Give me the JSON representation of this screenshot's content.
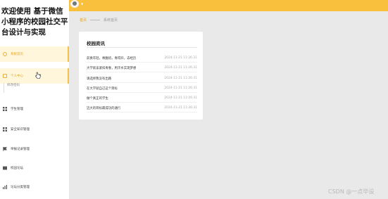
{
  "sidebar": {
    "app_title": "欢迎使用 基于微信小程序的校园社交平台设计与实现",
    "items": [
      {
        "label": "系统首页",
        "icon": "home-icon"
      },
      {
        "label": "个人中心",
        "icon": "user-icon"
      },
      {
        "label": "修改密码"
      },
      {
        "label": "学生管理",
        "icon": "grid-icon"
      },
      {
        "label": "安全知识管理",
        "icon": "grid-icon"
      },
      {
        "label": "举报记录管理",
        "icon": "flag-icon"
      },
      {
        "label": "校园论坛",
        "icon": "card-icon"
      },
      {
        "label": "论坛分类管理",
        "icon": "chart-icon"
      }
    ]
  },
  "breadcrumb": {
    "home": "首页",
    "current": "系统首页"
  },
  "news": {
    "title": "校园资讯",
    "items": [
      {
        "title": "前奏年轻，唤醒初，青得开，去经历",
        "time": "2024-11-21 11:26:31"
      },
      {
        "title": "大学就该紧扣青春，用汗水实现梦想",
        "time": "2024-11-21 11:26:31"
      },
      {
        "title": "请选择我没有出路",
        "time": "2024-11-21 11:26:31"
      },
      {
        "title": "在大学就自己这个目标",
        "time": "2024-11-21 11:26:31"
      },
      {
        "title": "做个真正的学生",
        "time": "2024-11-21 11:26:31"
      },
      {
        "title": "迈大的目标最成功的通行",
        "time": "2024-11-21 11:26:31"
      }
    ]
  },
  "watermark": "CSDN @一点毕设",
  "colors": {
    "accent": "#f9c03e",
    "accent_text": "#e3a321"
  }
}
